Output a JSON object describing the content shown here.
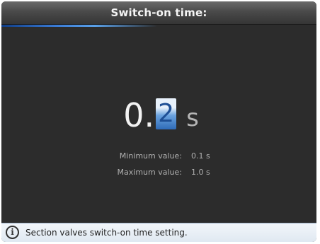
{
  "header": {
    "title": "Switch-on time:"
  },
  "value_editor": {
    "integer_part": "0.",
    "editing_digit": "2",
    "unit": "s"
  },
  "limits": {
    "min_label": "Minimum value:",
    "min_value": "0.1 s",
    "max_label": "Maximum value:",
    "max_value": "1.0 s"
  },
  "status": {
    "icon": "info-icon",
    "message": "Section valves switch-on time setting."
  },
  "colors": {
    "background": "#2c2c2c",
    "accent": "#3a7bd5",
    "status_bar": "#e4ecf4"
  }
}
